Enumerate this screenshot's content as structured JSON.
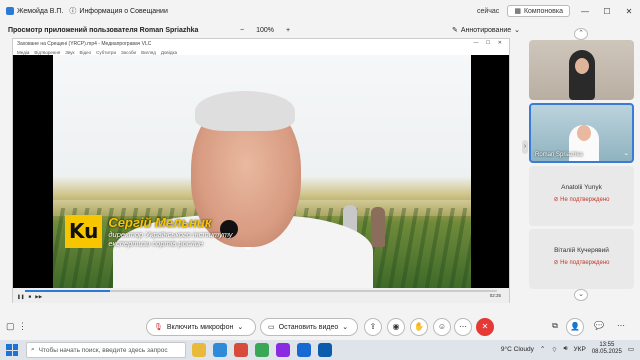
{
  "topbar": {
    "tab1": "Жемойда В.П.",
    "tab2": "Информация о Совещании",
    "status": "сейчас",
    "layout_label": "Компоновка",
    "win_min": "—",
    "win_max": "☐",
    "win_close": "✕"
  },
  "share": {
    "title": "Просмотр приложений пользователя Roman Spriazhka",
    "zoom_minus": "−",
    "zoom_value": "100%",
    "zoom_plus": "+",
    "annotate_label": "Аннотирование",
    "window_title": "Заховане на Срещені (YRCP).mp4 - Медиапрогравач VLC",
    "menu": [
      "Медіа",
      "Відтворення",
      "Звук",
      "Відео",
      "Субтитри",
      "Засоби",
      "Вигляд",
      "Довідка"
    ],
    "player_time_left": "00:00",
    "player_time_right": "02:35"
  },
  "video": {
    "logo": "Ku",
    "name": "Сергій Мельник",
    "role_line1": "директор Українського інституту",
    "role_line2": "експертизи сортів рослин"
  },
  "participants": [
    {
      "name": "",
      "status": ""
    },
    {
      "name": "Roman Spriazhka",
      "status": ""
    },
    {
      "name": "Anatolii Yunyk",
      "status": "Не подтверждено"
    },
    {
      "name": "Віталій Кучерявий",
      "status": "Не подтверждено"
    }
  ],
  "toolbar": {
    "mic_label": "Включить микрофон",
    "video_label": "Остановить видео"
  },
  "taskbar": {
    "search_placeholder": "Чтобы начать поиск, введите здесь запрос",
    "weather": "9°C  Cloudy",
    "lang": "УКР",
    "time": "13:55",
    "date": "08.05.2025"
  },
  "colors": {
    "accent": "#2b7bd6",
    "end_call": "#e53935",
    "logo_yellow": "#f7c600",
    "warning": "#c0392b"
  }
}
